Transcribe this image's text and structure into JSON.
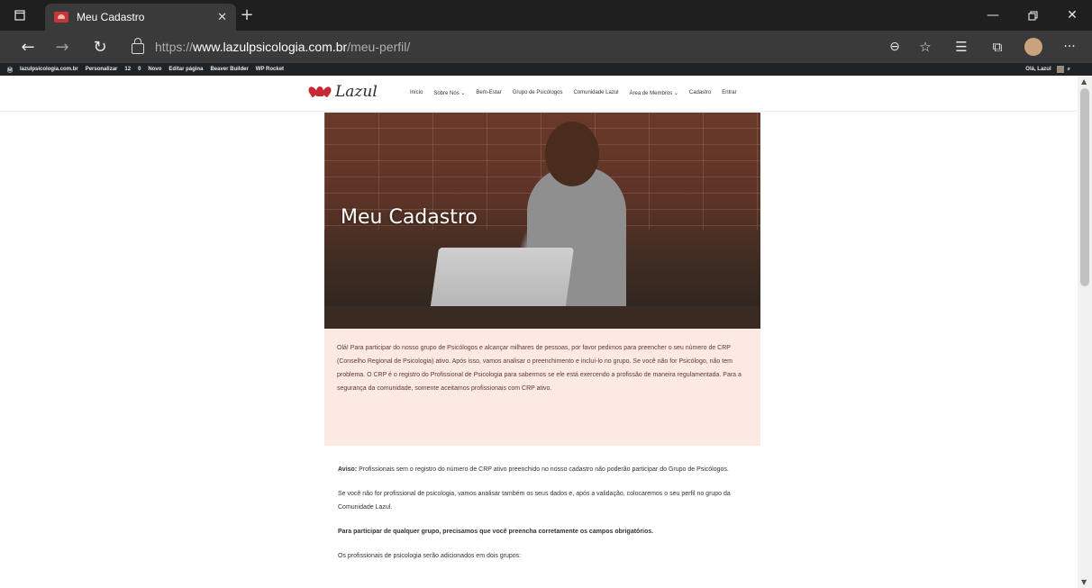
{
  "browser": {
    "tab_title": "Meu Cadastro",
    "url_scheme": "https://",
    "url_host": "www.lazulpsicologia.com.br",
    "url_path": "/meu-perfil/"
  },
  "wp_admin_bar": {
    "site": "lazulpsicologia.com.br",
    "customize": "Personalizar",
    "updates": "12",
    "comments": "0",
    "new": "Novo",
    "edit_page": "Editar página",
    "beaver": "Beaver Builder",
    "rocket": "WP Rocket",
    "greeting": "Olá, Lazul"
  },
  "site": {
    "logo_text": "Lazul",
    "menu": [
      "Início",
      "Sobre Nós",
      "Bem-Estar",
      "Grupo de Psicólogos",
      "Comunidade Lazul",
      "Área de Membros",
      "Cadastro",
      "Entrar"
    ]
  },
  "hero": {
    "title": "Meu Cadastro"
  },
  "intro": {
    "text": "Olá! Para participar do nosso grupo de Psicólogos e alcançar milhares de pessoas, por favor pedimos para preencher o seu número de CRP (Conselho Regional de Psicologia) ativo. Após isso, vamos analisar o preenchimento e incluí-lo no grupo. Se você não for Psicólogo, não tem problema. O CRP é o registro do Profissional de Psicologia para sabermos se ele está exercendo a profissão de maneira regulamentada. Para a segurança da comunidade, somente aceitamos profissionais com CRP ativo."
  },
  "content": {
    "notice_label": "Aviso:",
    "notice_text": "Profissionais sem o registro do número de CRP ativo preenchido no nosso cadastro não poderão participar do Grupo de Psicólogos.",
    "non_psych": "Se você não for profissional de psicologia, vamos analisar também os seus dados e, após a validação, colocaremos o seu perfil no grupo da Comunidade Lazul.",
    "required": "Para participar de qualquer grupo, precisamos que você preencha corretamente os campos obrigatórios.",
    "groups": "Os profissionais de psicologia serão adicionados em dois grupos:"
  }
}
